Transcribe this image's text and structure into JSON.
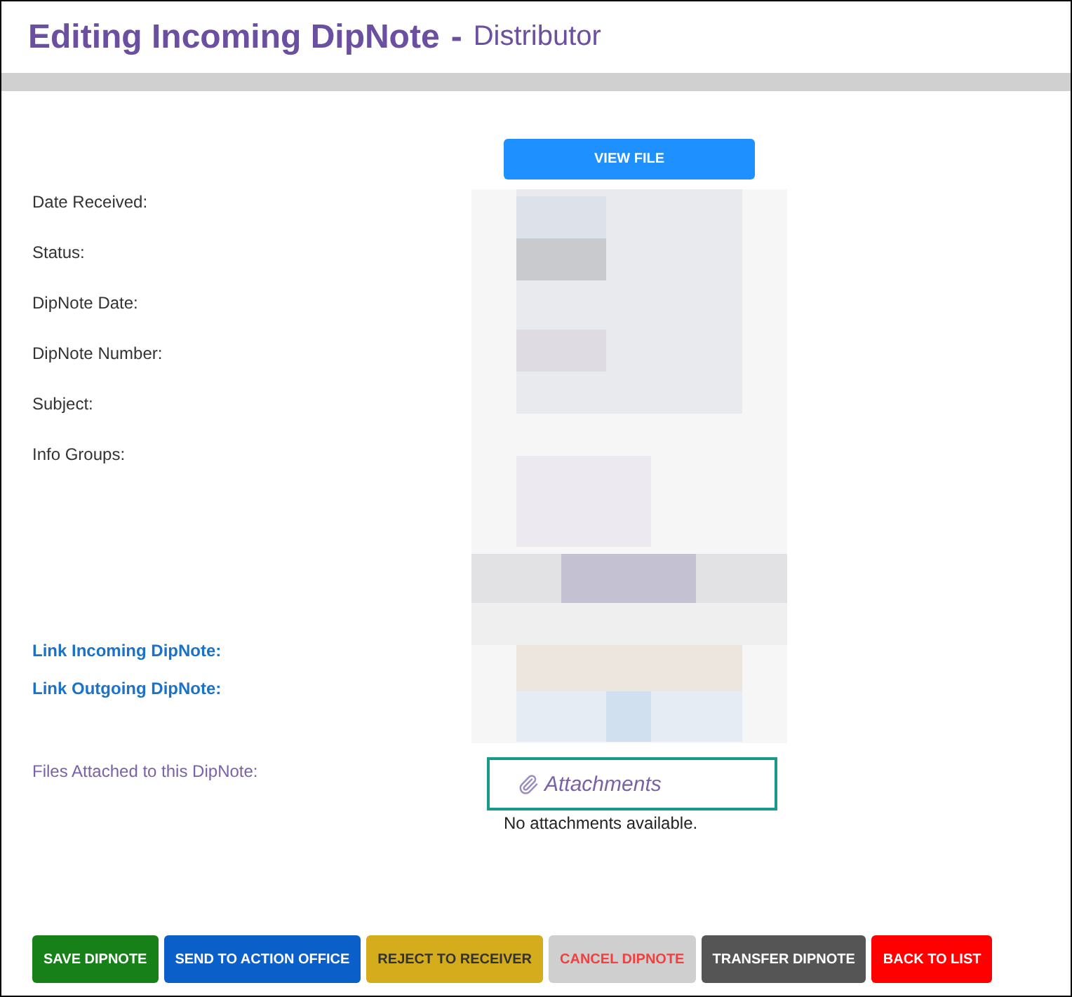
{
  "header": {
    "title": "Editing Incoming DipNote",
    "separator": "-",
    "subtitle": "Distributor"
  },
  "view_button": "VIEW FILE",
  "fields": [
    "Date Received:",
    "Status:",
    "DipNote Date:",
    "DipNote Number:",
    "Subject:",
    "Info Groups:"
  ],
  "links": [
    "Link Incoming DipNote:",
    "Link Outgoing DipNote:"
  ],
  "attachments": {
    "label": "Files Attached to this DipNote:",
    "heading": "Attachments",
    "empty_text": "No attachments available."
  },
  "buttons": [
    {
      "label": "SAVE DIPNOTE",
      "kind": "success"
    },
    {
      "label": "SEND TO ACTION OFFICE",
      "kind": "primary"
    },
    {
      "label": "REJECT TO RECEIVER",
      "kind": "warning"
    },
    {
      "label": "CANCEL DIPNOTE",
      "kind": "muted"
    },
    {
      "label": "TRANSFER DIPNOTE",
      "kind": "dark"
    },
    {
      "label": "BACK TO LIST",
      "kind": "danger"
    }
  ]
}
